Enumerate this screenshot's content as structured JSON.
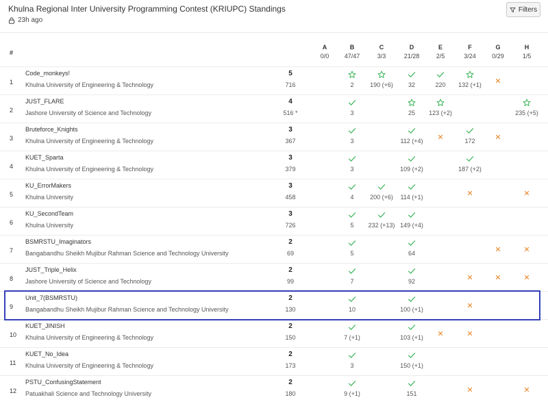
{
  "header": {
    "title": "Khulna Regional Inter University Programming Contest (KRIUPC) Standings",
    "time": "23h ago",
    "filters_label": "Filters"
  },
  "columns": {
    "rank": "#",
    "problems": [
      {
        "letter": "A",
        "ratio": "0/0"
      },
      {
        "letter": "B",
        "ratio": "47/47"
      },
      {
        "letter": "C",
        "ratio": "3/3"
      },
      {
        "letter": "D",
        "ratio": "21/28"
      },
      {
        "letter": "E",
        "ratio": "2/5"
      },
      {
        "letter": "F",
        "ratio": "3/24"
      },
      {
        "letter": "G",
        "ratio": "0/29"
      },
      {
        "letter": "H",
        "ratio": "1/5"
      }
    ]
  },
  "rows": [
    {
      "rank": "1",
      "team": "Code_monkeys!",
      "university": "Khulna University of Engineering & Technology",
      "solved": "5",
      "penalty": "716",
      "cells": {
        "B": {
          "status": "first",
          "time": "2"
        },
        "C": {
          "status": "first",
          "time": "190 (+6)"
        },
        "D": {
          "status": "solved",
          "time": "32"
        },
        "E": {
          "status": "solved",
          "time": "220"
        },
        "F": {
          "status": "first",
          "time": "132 (+1)"
        },
        "G": {
          "status": "wrong"
        }
      }
    },
    {
      "rank": "2",
      "team": "JUST_FLARE",
      "university": "Jashore University of Science and Technology",
      "solved": "4",
      "penalty": "516 *",
      "cells": {
        "B": {
          "status": "solved",
          "time": "3"
        },
        "D": {
          "status": "first",
          "time": "25"
        },
        "E": {
          "status": "first",
          "time": "123 (+2)"
        },
        "H": {
          "status": "first",
          "time": "235 (+5)"
        }
      }
    },
    {
      "rank": "3",
      "team": "Bruteforce_Knights",
      "university": "Khulna University of Engineering & Technology",
      "solved": "3",
      "penalty": "367",
      "cells": {
        "B": {
          "status": "solved",
          "time": "3"
        },
        "D": {
          "status": "solved",
          "time": "112 (+4)"
        },
        "E": {
          "status": "wrong"
        },
        "F": {
          "status": "solved",
          "time": "172"
        },
        "G": {
          "status": "wrong"
        }
      }
    },
    {
      "rank": "4",
      "team": "KUET_Sparta",
      "university": "Khulna University of Engineering & Technology",
      "solved": "3",
      "penalty": "379",
      "cells": {
        "B": {
          "status": "solved",
          "time": "3"
        },
        "D": {
          "status": "solved",
          "time": "109 (+2)"
        },
        "F": {
          "status": "solved",
          "time": "187 (+2)"
        }
      }
    },
    {
      "rank": "5",
      "team": "KU_ErrorMakers",
      "university": "Khulna University",
      "solved": "3",
      "penalty": "458",
      "cells": {
        "B": {
          "status": "solved",
          "time": "4"
        },
        "C": {
          "status": "solved",
          "time": "200 (+6)"
        },
        "D": {
          "status": "solved",
          "time": "114 (+1)"
        },
        "F": {
          "status": "wrong"
        },
        "H": {
          "status": "wrong"
        }
      }
    },
    {
      "rank": "6",
      "team": "KU_SecondTeam",
      "university": "Khulna University",
      "solved": "3",
      "penalty": "726",
      "cells": {
        "B": {
          "status": "solved",
          "time": "5"
        },
        "C": {
          "status": "solved",
          "time": "232 (+13)"
        },
        "D": {
          "status": "solved",
          "time": "149 (+4)"
        }
      }
    },
    {
      "rank": "7",
      "team": "BSMRSTU_Imaginators",
      "university": "Bangabandhu Sheikh Mujibur Rahman Science and Technology University",
      "solved": "2",
      "penalty": "69",
      "cells": {
        "B": {
          "status": "solved",
          "time": "5"
        },
        "D": {
          "status": "solved",
          "time": "64"
        },
        "G": {
          "status": "wrong"
        },
        "H": {
          "status": "wrong"
        }
      }
    },
    {
      "rank": "8",
      "team": "JUST_Triple_Helix",
      "university": "Jashore University of Science and Technology",
      "solved": "2",
      "penalty": "99",
      "cells": {
        "B": {
          "status": "solved",
          "time": "7"
        },
        "D": {
          "status": "solved",
          "time": "92"
        },
        "F": {
          "status": "wrong"
        },
        "G": {
          "status": "wrong"
        },
        "H": {
          "status": "wrong"
        }
      }
    },
    {
      "rank": "9",
      "team": "Unit_7(BSMRSTU)",
      "university": "Bangabandhu Sheikh Mujibur Rahman Science and Technology University",
      "solved": "2",
      "penalty": "130",
      "cells": {
        "B": {
          "status": "solved",
          "time": "10"
        },
        "D": {
          "status": "solved",
          "time": "100 (+1)"
        },
        "F": {
          "status": "wrong"
        }
      }
    },
    {
      "rank": "10",
      "team": "KUET_JINISH",
      "university": "Khulna University of Engineering & Technology",
      "solved": "2",
      "penalty": "150",
      "cells": {
        "B": {
          "status": "solved",
          "time": "7 (+1)"
        },
        "D": {
          "status": "solved",
          "time": "103 (+1)"
        },
        "E": {
          "status": "wrong"
        },
        "F": {
          "status": "wrong"
        }
      }
    },
    {
      "rank": "11",
      "team": "KUET_No_Idea",
      "university": "Khulna University of Engineering & Technology",
      "solved": "2",
      "penalty": "173",
      "cells": {
        "B": {
          "status": "solved",
          "time": "3"
        },
        "D": {
          "status": "solved",
          "time": "150 (+1)"
        }
      }
    },
    {
      "rank": "12",
      "team": "PSTU_ConfusingStatement",
      "university": "Patuakhali Science and Technology University",
      "solved": "2",
      "penalty": "180",
      "cells": {
        "B": {
          "status": "solved",
          "time": "9 (+1)"
        },
        "D": {
          "status": "solved",
          "time": "151"
        },
        "F": {
          "status": "wrong"
        },
        "H": {
          "status": "wrong"
        }
      }
    }
  ],
  "highlighted_rank": "9",
  "colors": {
    "solved": "#3cb55a",
    "wrong": "#e8892b",
    "highlight": "#3340b8"
  }
}
